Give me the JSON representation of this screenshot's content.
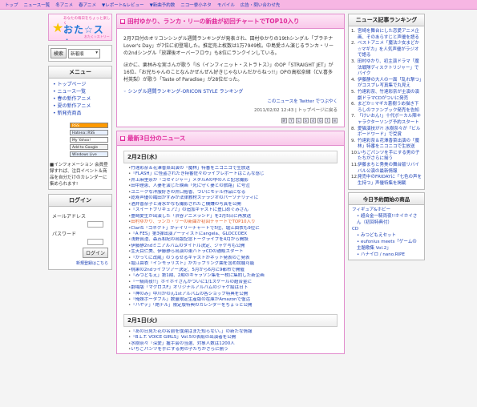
{
  "topnav": [
    "トップ",
    "ニュース一覧",
    "冬アニメ",
    "春アニメ",
    "▼レポート&レビュー",
    "▼新曲予約数",
    "ニコ一挙小ネタ",
    "モバイル",
    "広告・問い合わせ先"
  ],
  "logo": {
    "sub": "あなたの毎日をちょっと楽しく",
    "main": "おた☆スト",
    "tag": "おたく☆ストリート"
  },
  "search": {
    "button": "検索",
    "select": "新着順"
  },
  "menu": {
    "title": "メニュー",
    "items": [
      "トップページ",
      "ニュース一覧",
      "春の新作アニメ",
      "夏の新作アニメ",
      "新発売商品"
    ]
  },
  "badges": [
    "RSS",
    "Hatena::RSS",
    "My Yahoo!",
    "Add to Google",
    "Windows Live"
  ],
  "info": "■インフォメーション 会員登録すれば、注目イベント＆商品を自分だけのカレンダーに集められます!",
  "login": {
    "title": "ログイン",
    "mail_label": "メールアドレス",
    "pass_label": "パスワード",
    "button": "ログイン",
    "foot": "新規登録はこちら"
  },
  "article": {
    "title": "田村ゆかり、ランカ・リーの新曲が初回チャートでTOP10入り",
    "p1": "2月7日付のオリコンシングル週間ランキングが発表され、田村ゆかりの19thシングル「プラチナLover's Day」が7位に初登場した。推定売上枚数は1万7949枚。中島愛さん演じるランカ・リーの2ndシングル「放課後オーバーフロウ」も8位にランクインしている。",
    "p2": "ほかに、栗林みな実さんが歌う「IS〈インフィニット・ストラトス〉」のOP「STRAIGHT JET」が16位、「お兄ちゃんのことなんかぜんぜん好きじゃないんだからねっ!!」OPの高松奈緒（CV.喜多村英梨）が歌う「Taste of Paradise」が28位だった。",
    "ref": "シングル週間ランキング-ORICON STYLE ランキング",
    "share": "このニュースを Twitter でつぶやく",
    "meta": "2011/02/02 12:43 | トップページに戻る"
  },
  "news": {
    "title": "最新3日分のニュース",
    "day1": "2月2日(水)",
    "day1_items": [
      "竹達彩奈＆花澤香菜出演の「魔林」特番をニコニコで生放送",
      "「FLASH」に怪盗されたき特番佐々のライブレポートはこんな感じ",
      "井上麻里奈が「ゴセイジャー」メタルAの中の人と記念撮影",
      "田中理恵、人妻を演じた映画「死に守く妻との旅路」に号泣",
      "ユニークな洋服好きの井口裕香、ついにモデル作品になる",
      "乾寿声優の織田かずみが法律教材ステラジオのパーソナリティに",
      "酒井香奈子と清水かなも撮影されたご機嫌の写真を公開",
      "「スイートプリキュア♪」の追加キャストに豊口めぐみさん",
      "豊崎愛生が出演した「渋谷アニメランド」を2月5日に再放送",
      "田村ゆかり、ランカ・リーの新曲が初回チャートでTOP10入り",
      "ClariS「コネクト」がデイリーチャートで5位、堀江由衣も9位に",
      "「A FES」第3弾出演アーティストにangela、GLOCCOEX",
      "浅野真澄、森苏和紀の出版記念トークライブを4月から開設",
      "伊藤静2ndミニアルバムのタイトル決定、ジャケ写も公開",
      "生天目仁美、伊藤静ら出演の東ハトラCDの通販スタート",
      "「かってに改蔵」のうるせるキャストがネット発表のご発表",
      "堀江由衣「インモラリスト」がカップリング曲を含め試聴可能",
      "桃果の2ndライブツアー決定、5月から6月に9都市で開催",
      "「みつどもえ」第1期、2期のキャラソン集を一枚に集約した新企画",
      "「一騎両夜!!」ホイホイさんがついに1/1スケールの超合金に",
      "劇場版「マクロスF」オリジナルアルバムのジャケ絵は日下",
      "「神のみ」中川かのん1stアルバムの各ショップ特典を公開",
      "「俺妹ポータブル」数量限定生産版の在庫がAmazonで復活",
      "「ハヤテ」「絶チル」限定版特典のカレンダーをちょっと公開"
    ],
    "day2": "2月1日(火)",
    "day2_items": [
      "「あの日見た花の名前を僕達はまだ知らない。」の新たな情報",
      "「B.L.T. VOICE GIRLS」Vol.5の表紙の出演者を公開",
      "水樹奈々「深愛」握手会の当選、対象人数は1200人",
      "いちごパンツを手にする男の子たちがさらに揃う"
    ]
  },
  "rank": {
    "title": "ニュース記事ランキング",
    "items": [
      "宮崎を舞台にした恋愛アニメ企画、そのあらすじと声優を語る",
      "ベストアニメ「魔法少女まどか☆マギカ」を人気声優がラジオで語る",
      "田村ゆかり、初主演ドラマ「魔法戦隊ディスクトリジャー」でバイク",
      "伊藤静の大人の一面「乱れ撃つ」がコスプレ写真集で丸見え",
      "竹達彩奈、竹達彩奈が主演の演劇ドラマCDがついに発売",
      "まどか☆マギカ蒼樹うめ描き下ろしのファンブック発売を告知",
      "「けいおん!」十代ボーカル陣キャラクターソング予約スタート",
      "愛猫演技が?! 水樹奈々が「ビルボードワード」で受賞",
      "竹達彩奈＆花澤香菜出演の「魔林」特番をニコニコで生放送",
      "いちごパンツを手にする男の子たちがさらに揃う",
      "伊藤まちと秀美の舞台版リバイバル公演の最新情報",
      "発売中のFRIDAYに「七色の声を生持つ」声優特集を掲載"
    ]
  },
  "shop": {
    "title": "今日予約開始の商品",
    "cat1": "フィギュア&ホビー",
    "items1": [
      "超合金一騎両夜!!ホイホイさん（初回特典付）"
    ],
    "cat2": "CD",
    "items2": [
      "みつどもえセット",
      "eufonius meets「ゲームの主題歌集 Vol.2」",
      "ハナイロ / nano.RIPE"
    ]
  }
}
